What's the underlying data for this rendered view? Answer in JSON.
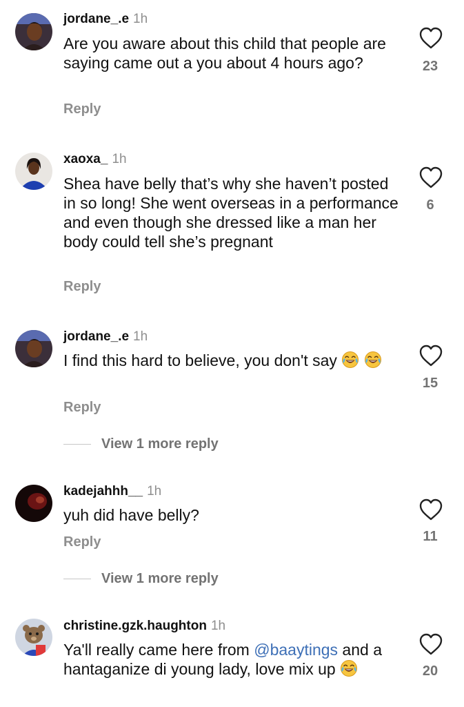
{
  "comments": [
    {
      "username": "jordane_.e",
      "time": "1h",
      "text": "Are you aware about this child that people are saying came out a you about 4 hours ago?",
      "reply_label": "Reply",
      "like_count": "23"
    },
    {
      "username": "xaoxa_",
      "time": "1h",
      "text": "Shea have belly that’s why she haven’t posted in so long! She went overseas in a performance and even though she dressed like a man her body could tell she’s pregnant",
      "reply_label": "Reply",
      "like_count": "6"
    },
    {
      "username": "jordane_.e",
      "time": "1h",
      "text": "I find this hard to believe, you don't say",
      "reply_label": "Reply",
      "like_count": "15",
      "view_more_label": "View 1 more reply"
    },
    {
      "username": "kadejahhh__",
      "time": "1h",
      "text": "yuh did have belly?",
      "reply_label": "Reply",
      "like_count": "11",
      "view_more_label": "View 1 more reply"
    },
    {
      "username": "christine.gzk.haughton",
      "time": "1h",
      "text_before": "Ya'll really came here from ",
      "mention": "@baaytings",
      "text_after": " and a hantaganize di young lady, love mix up",
      "like_count": "20"
    }
  ],
  "icons": {
    "like": "heart-outline-icon",
    "emoji": "face-with-tears-of-joy-emoji"
  },
  "colors": {
    "mention": "#3d6fb6",
    "secondary_text": "#8e8e8e",
    "count_text": "#737373"
  }
}
